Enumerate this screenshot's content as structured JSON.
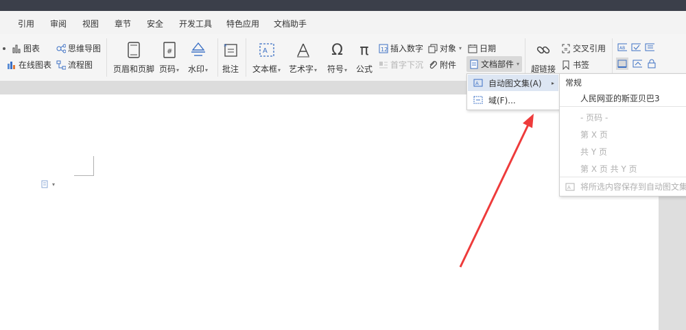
{
  "menubar": {
    "items": [
      "引用",
      "审阅",
      "视图",
      "章节",
      "安全",
      "开发工具",
      "特色应用",
      "文档助手"
    ]
  },
  "ribbon": {
    "chart": "图表",
    "online_chart": "在线图表",
    "mindmap": "思维导图",
    "flowchart": "流程图",
    "header_footer": "页眉和页脚",
    "page_number": "页码",
    "watermark": "水印",
    "comment": "批注",
    "textbox": "文本框",
    "wordart": "艺术字",
    "symbol": "符号",
    "formula": "公式",
    "insert_number": "插入数字",
    "object": "对象",
    "date": "日期",
    "drop_cap": "首字下沉",
    "attachment": "附件",
    "doc_parts": "文档部件",
    "hyperlink": "超链接",
    "cross_ref": "交叉引用",
    "bookmark": "书签"
  },
  "dropdown": {
    "autotext": "自动图文集(A)",
    "field": "域(F)..."
  },
  "submenu": {
    "header": "常规",
    "entry": "人民网亚的斯亚贝巴3",
    "page_code": "- 页码 -",
    "page_x": "第 X 页",
    "total_y": "共 Y 页",
    "page_x_of_y": "第 X 页 共 Y 页",
    "save_selection": "将所选内容保存到自动图文集库"
  },
  "colors": {
    "titlebar": "#3b3f4a",
    "highlight": "#dde6f3",
    "arrow": "#ee3b3b"
  }
}
